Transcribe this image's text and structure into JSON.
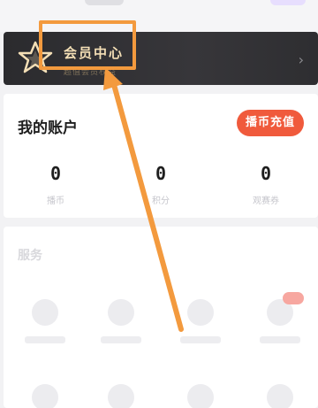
{
  "vip": {
    "title": "会员中心",
    "subtitle": "超值会员权益"
  },
  "account": {
    "title": "我的账户",
    "recharge_label": "播币充值",
    "stats": [
      {
        "value": "0",
        "label": "播币"
      },
      {
        "value": "0",
        "label": "积分"
      },
      {
        "value": "0",
        "label": "观赛券"
      }
    ]
  },
  "services": {
    "title": "服务"
  },
  "colors": {
    "highlight": "#f39a3e",
    "recharge_bg": "#f05a3c",
    "vip_gold": "#f4dfb6"
  },
  "icons": {
    "vip": "star-icon",
    "arrow": "chevron-right-icon"
  }
}
